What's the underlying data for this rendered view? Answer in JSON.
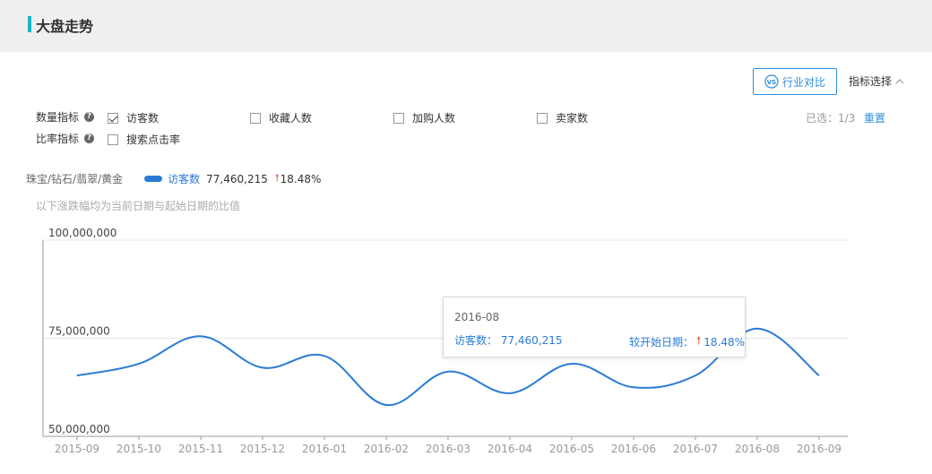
{
  "header": {
    "title": "大盘走势"
  },
  "toolbar": {
    "compare_label": "行业对比",
    "metric_select_label": "指标选择"
  },
  "filters": {
    "quantity_label": "数量指标",
    "ratio_label": "比率指标",
    "quantity_options": [
      {
        "label": "访客数",
        "checked": true
      },
      {
        "label": "收藏人数",
        "checked": false
      },
      {
        "label": "加购人数",
        "checked": false
      },
      {
        "label": "卖家数",
        "checked": false
      }
    ],
    "ratio_options": [
      {
        "label": "搜索点击率",
        "checked": false
      }
    ],
    "selected_count": "已选：1/3",
    "reset_label": "重置"
  },
  "legend": {
    "category": "珠宝/钻石/翡翠/黄金",
    "series_name": "访客数",
    "value": "77,460,215",
    "change": "18.48%"
  },
  "note": "以下涨跌幅均为当前日期与起始日期的比值",
  "tooltip": {
    "date": "2016-08",
    "visitors_text": "访客数： 77,460,215",
    "change_label": "较开始日期：",
    "change_value": "18.48%"
  },
  "colors": {
    "accent": "#2a7bd6",
    "up_arrow": "#e85a45",
    "header_bar": "#17b6c8"
  },
  "chart_data": {
    "type": "line",
    "categories": [
      "2015-09",
      "2015-10",
      "2015-11",
      "2015-12",
      "2016-01",
      "2016-02",
      "2016-03",
      "2016-04",
      "2016-05",
      "2016-06",
      "2016-07",
      "2016-08",
      "2016-09"
    ],
    "series": [
      {
        "name": "访客数",
        "values": [
          65500000,
          68500000,
          75500000,
          67500000,
          70500000,
          58000000,
          66500000,
          61000000,
          68500000,
          62500000,
          65500000,
          77460215,
          65500000
        ]
      }
    ],
    "y_tick_labels": [
      "100,000,000",
      "75,000,000",
      "50,000,000"
    ],
    "y_ticks": [
      100000000,
      75000000,
      50000000
    ],
    "ylim": [
      50000000,
      100000000
    ],
    "grid": true
  }
}
